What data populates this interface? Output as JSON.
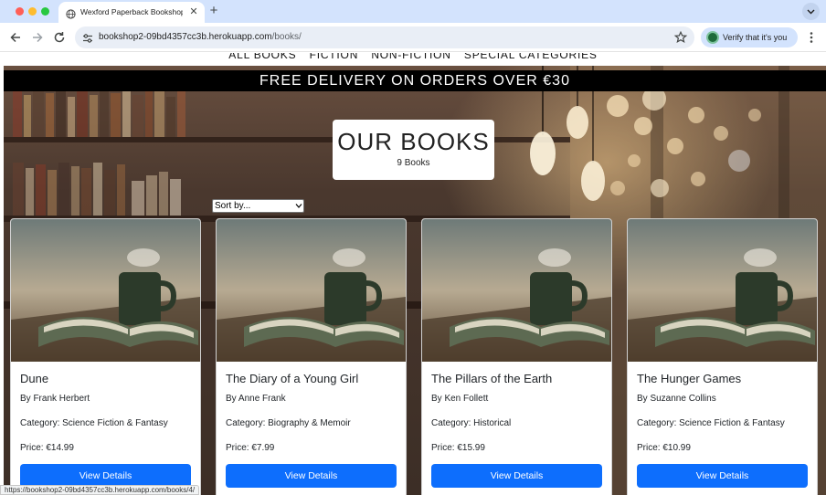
{
  "browser": {
    "tab_title": "Wexford Paperback Bookshop",
    "url_host": "bookshop2-09bd4357cc3b.herokuapp.com",
    "url_path": "/books/",
    "verify_label": "Verify that it's you",
    "status_url": "https://bookshop2-09bd4357cc3b.herokuapp.com/books/4/"
  },
  "nav": {
    "items": [
      "ALL BOOKS",
      "FICTION",
      "NON-FICTION",
      "SPECIAL CATEGORIES"
    ]
  },
  "banner": {
    "text": "FREE DELIVERY ON ORDERS OVER €30"
  },
  "heading": {
    "title": "OUR BOOKS",
    "count": "9 Books"
  },
  "sort": {
    "label": "Sort by..."
  },
  "books": [
    {
      "title": "Dune",
      "author": "By Frank Herbert",
      "category": "Category: Science Fiction & Fantasy",
      "price": "Price: €14.99",
      "button": "View Details"
    },
    {
      "title": "The Diary of a Young Girl",
      "author": "By Anne Frank",
      "category": "Category: Biography & Memoir",
      "price": "Price: €7.99",
      "button": "View Details"
    },
    {
      "title": "The Pillars of the Earth",
      "author": "By Ken Follett",
      "category": "Category: Historical",
      "price": "Price: €15.99",
      "button": "View Details"
    },
    {
      "title": "The Hunger Games",
      "author": "By Suzanne Collins",
      "category": "Category: Science Fiction & Fantasy",
      "price": "Price: €10.99",
      "button": "View Details"
    }
  ],
  "colors": {
    "tabbar": "#d3e3fd",
    "primary_button": "#0d6efd",
    "banner_bg": "#000000"
  }
}
